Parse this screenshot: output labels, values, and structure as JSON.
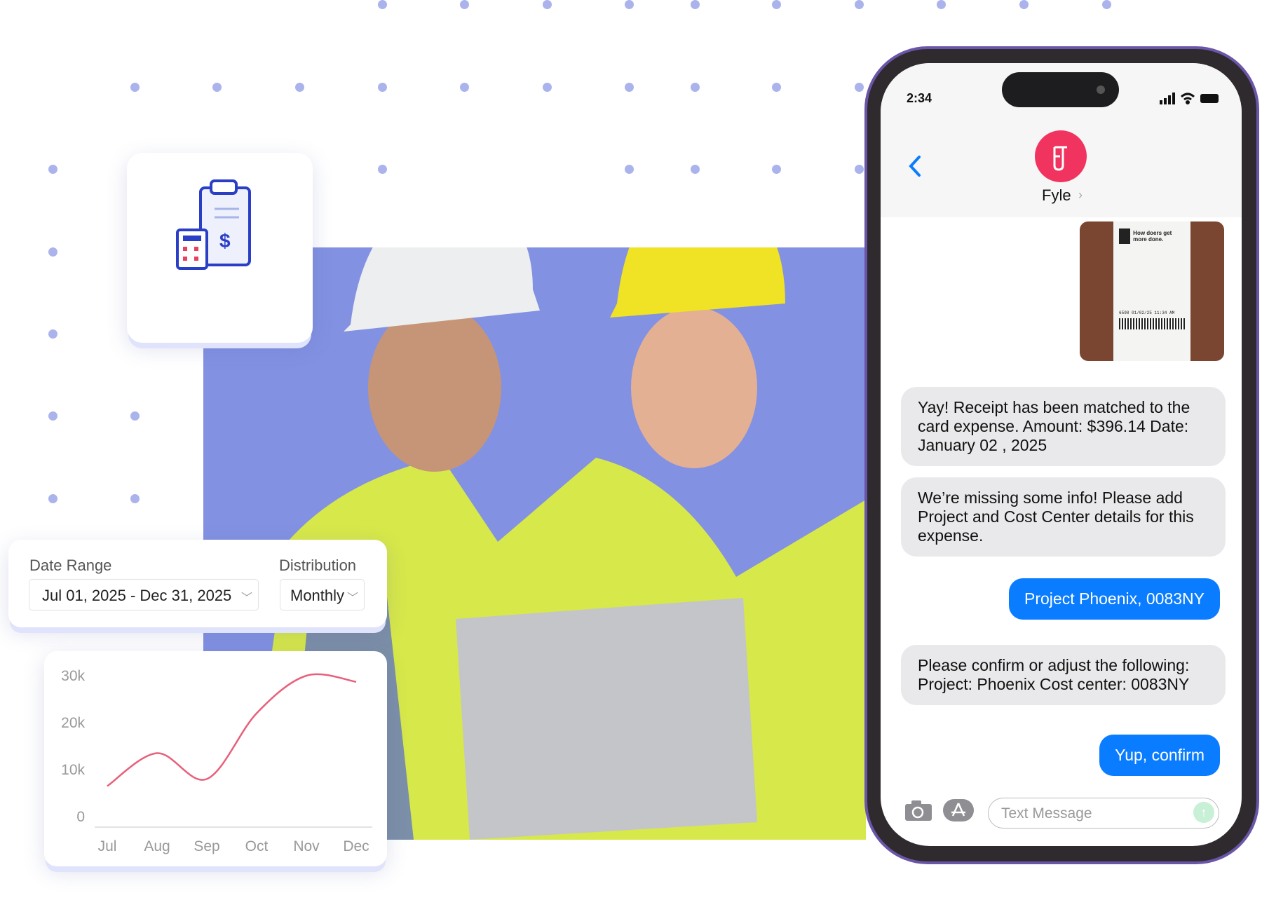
{
  "colors": {
    "accent_blue": "#0a7cff",
    "brand_pink": "#f0345f",
    "bg_block": "#8391e2",
    "line": "#e8607a"
  },
  "filters": {
    "date_range_label": "Date Range",
    "date_range_value": "Jul 01, 2025 - Dec 31, 2025",
    "distribution_label": "Distribution",
    "distribution_value": "Monthly"
  },
  "chart_data": {
    "type": "line",
    "categories": [
      "Jul",
      "Aug",
      "Sep",
      "Oct",
      "Nov",
      "Dec"
    ],
    "values": [
      6500,
      13500,
      8000,
      22000,
      30000,
      28700
    ],
    "yticks": [
      "0",
      "10k",
      "20k",
      "30k"
    ],
    "ylim": [
      0,
      30000
    ],
    "grid": false
  },
  "phone": {
    "time": "2:34",
    "contact": "Fyle",
    "icons": [
      "back-chevron",
      "signal",
      "wifi",
      "battery",
      "camera",
      "app-store",
      "send-arrow"
    ],
    "messages": [
      {
        "from": "bot",
        "text": "Yay! Receipt has been matched to the card expense. Amount: $396.14 Date: January 02 , 2025"
      },
      {
        "from": "bot",
        "text": "We’re missing some info! Please add Project and Cost Center details for this expense."
      },
      {
        "from": "user",
        "text": "Project Phoenix, 0083NY"
      },
      {
        "from": "bot",
        "text": "Please confirm or adjust the following: Project: Phoenix  Cost center: 0083NY"
      },
      {
        "from": "user",
        "text": "Yup, confirm"
      }
    ],
    "input_placeholder": "Text Message",
    "receipt": {
      "tagline": "How doers get more done.",
      "line": "6598  01/02/25  11:34 AM"
    }
  }
}
